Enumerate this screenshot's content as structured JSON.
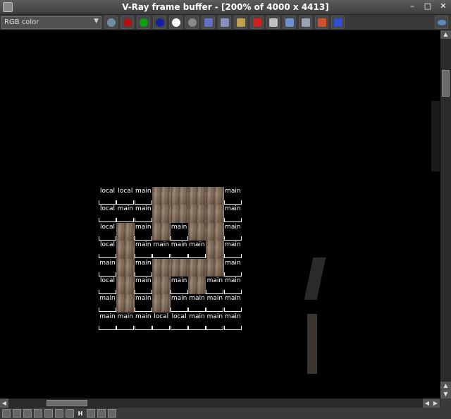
{
  "window": {
    "title": "V-Ray frame buffer - [200% of 4000 x 4413]",
    "buttons": [
      "–",
      "□",
      "✕"
    ]
  },
  "toolbar": {
    "channel": "RGB color",
    "icons": [
      {
        "name": "rgb-channel-icon",
        "color": "#6f8f9f"
      },
      {
        "name": "red-channel-icon",
        "color": "#b01010"
      },
      {
        "name": "green-channel-icon",
        "color": "#10a010"
      },
      {
        "name": "blue-channel-icon",
        "color": "#1020a0"
      },
      {
        "name": "alpha-channel-icon",
        "color": "#ffffff"
      },
      {
        "name": "monochrome-icon",
        "color": "#888888"
      },
      {
        "name": "save-image-icon",
        "color": "#6070c0"
      },
      {
        "name": "save-all-icon",
        "color": "#8890c0"
      },
      {
        "name": "load-image-icon",
        "color": "#c0a050"
      },
      {
        "name": "clear-image-icon",
        "color": "#d02020"
      },
      {
        "name": "track-mouse-icon",
        "color": "#c0c0c0"
      },
      {
        "name": "render-region-icon",
        "color": "#7090d0"
      },
      {
        "name": "link-to-viewport-icon",
        "color": "#9aa0b0"
      },
      {
        "name": "compare-ab-icon",
        "color": "#d05030"
      },
      {
        "name": "compare-ab-split-icon",
        "color": "#3050d0"
      }
    ],
    "right_icon": "show-corrections-icon"
  },
  "render": {
    "buckets": [
      [
        "local",
        "local",
        "main",
        "",
        "",
        "",
        "",
        "main"
      ],
      [
        "local",
        "main",
        "main",
        "",
        "",
        "",
        "",
        "main"
      ],
      [
        "local",
        "",
        "main",
        "",
        "main",
        "",
        "",
        "main"
      ],
      [
        "local",
        "",
        "main",
        "main",
        "main",
        "main",
        "",
        "main"
      ],
      [
        "main",
        "",
        "main",
        "",
        "",
        "",
        "",
        "main"
      ],
      [
        "local",
        "",
        "main",
        "",
        "main",
        "",
        "main",
        "main"
      ],
      [
        "main",
        "",
        "main",
        "",
        "main",
        "main",
        "main",
        "main"
      ],
      [
        "main",
        "main",
        "main",
        "local",
        "local",
        "main",
        "main",
        "main"
      ]
    ],
    "rendered_cells": [
      [
        0,
        3
      ],
      [
        0,
        4
      ],
      [
        0,
        5
      ],
      [
        0,
        6
      ],
      [
        1,
        3
      ],
      [
        1,
        4
      ],
      [
        1,
        5
      ],
      [
        1,
        6
      ],
      [
        2,
        1
      ],
      [
        2,
        3
      ],
      [
        2,
        5
      ],
      [
        2,
        6
      ],
      [
        3,
        1
      ],
      [
        3,
        6
      ],
      [
        4,
        1
      ],
      [
        4,
        3
      ],
      [
        4,
        4
      ],
      [
        4,
        5
      ],
      [
        4,
        6
      ],
      [
        5,
        1
      ],
      [
        5,
        3
      ],
      [
        5,
        5
      ],
      [
        6,
        1
      ],
      [
        6,
        3
      ]
    ]
  },
  "bottombar": {
    "icons": [
      "render-history-icon",
      "image-info-icon",
      "level-adjust-icon",
      "curve-icon",
      "exposure-icon",
      "lut-icon",
      "histogram-icon",
      "h-icon",
      "sRGB-icon",
      "ocio-icon",
      "lens-effects-icon"
    ],
    "h_label": "H"
  }
}
